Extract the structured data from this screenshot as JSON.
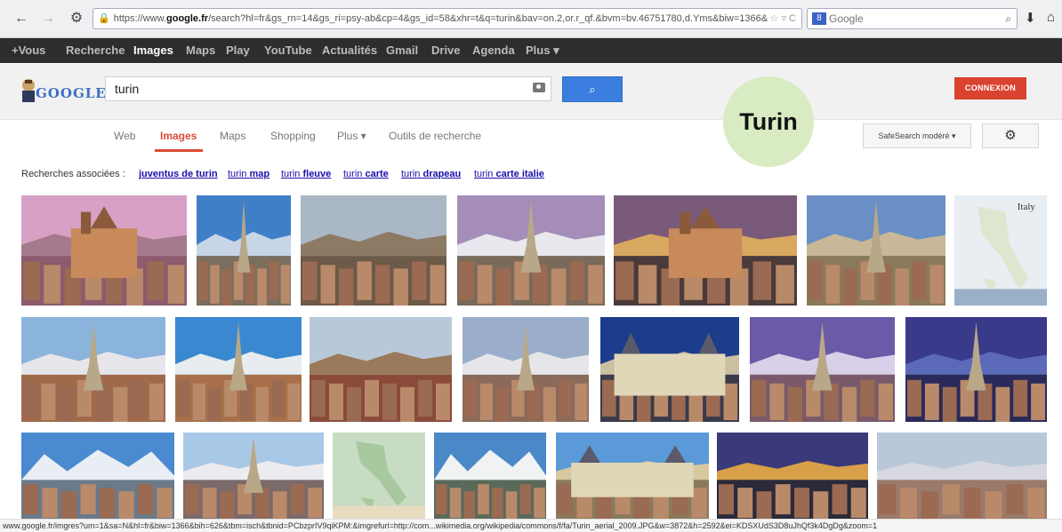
{
  "browser": {
    "url_prefix": "https://www.",
    "url_domain": "google.fr",
    "url_rest": "/search?hl=fr&gs_rn=14&gs_ri=psy-ab&cp=4&gs_id=58&xhr=t&q=turin&bav=on.2,or.r_qf.&bvm=bv.46751780,d.Yms&biw=1366&",
    "search_engine_placeholder": "Google"
  },
  "gbar": {
    "items": [
      "+Vous",
      "Recherche",
      "Images",
      "Maps",
      "Play",
      "YouTube",
      "Actualités",
      "Gmail",
      "Drive",
      "Agenda",
      "Plus ▾"
    ],
    "active_index": 2
  },
  "header": {
    "logo_text": "GOOGLE",
    "search_query": "turin",
    "connexion_label": "CONNEXION"
  },
  "subnav": {
    "items": [
      "Web",
      "Images",
      "Maps",
      "Shopping",
      "Plus ▾",
      "Outils de recherche"
    ],
    "active_index": 1
  },
  "annotation": {
    "label": "Turin"
  },
  "safesearch_label": "SafeSearch modéré ▾",
  "related": {
    "label": "Recherches associées :",
    "links": [
      {
        "prefix": "",
        "bold": "juventus de turin"
      },
      {
        "prefix": "turin ",
        "bold": "map"
      },
      {
        "prefix": "turin ",
        "bold": "fleuve"
      },
      {
        "prefix": "turin ",
        "bold": "carte"
      },
      {
        "prefix": "turin ",
        "bold": "drapeau"
      },
      {
        "prefix": "turin ",
        "bold": "carte italie"
      }
    ]
  },
  "map_thumb_label": "Italy",
  "status_url": "www.google.fr/imgres?um=1&sa=N&hl=fr&biw=1366&bih=626&tbm=isch&tbnid=PCbzprIV9qiKPM:&imgrefurl=http://com...wikimedia.org/wikipedia/commons/f/fa/Turin_aerial_2009.JPG&w=3872&h=2592&ei=KDSXUdS3D8uJhQf3k4DgDg&zoom=1",
  "colors": {
    "gbar_bg": "#2d2d2d",
    "accent_red": "#dd4b39",
    "search_button": "#3c7ee0",
    "annotation_circle": "#d8ebc2",
    "link": "#1a0dab"
  }
}
